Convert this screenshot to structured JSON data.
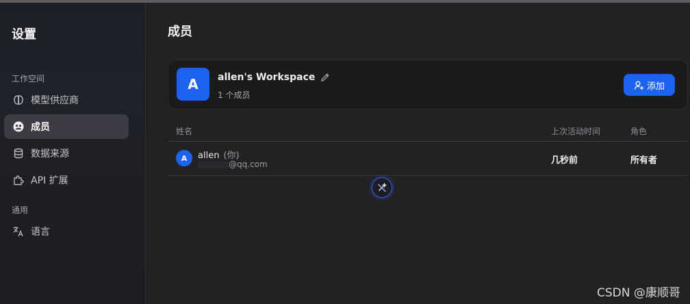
{
  "sidebar": {
    "title": "设置",
    "group_workspace": "工作空间",
    "group_general": "通用",
    "items": [
      {
        "label": "模型供应商",
        "icon": "brain-icon"
      },
      {
        "label": "成员",
        "icon": "members-icon",
        "active": true
      },
      {
        "label": "数据来源",
        "icon": "database-icon"
      },
      {
        "label": "API 扩展",
        "icon": "puzzle-icon"
      },
      {
        "label": "语言",
        "icon": "translate-icon"
      }
    ]
  },
  "main": {
    "title": "成员",
    "workspace": {
      "avatar_letter": "A",
      "name": "allen's Workspace",
      "member_count": "1 个成员",
      "add_button": "添加"
    },
    "table": {
      "headers": [
        "姓名",
        "上次活动时间",
        "角色"
      ],
      "rows": [
        {
          "avatar_letter": "A",
          "name": "allen",
          "you_tag": "(你)",
          "email_visible": "@qq.com",
          "last_active": "几秒前",
          "role": "所有者"
        }
      ]
    }
  },
  "watermark": "CSDN @康顺哥",
  "colors": {
    "accent": "#1d62f0",
    "background": "#222225",
    "sidebar": "#1e1f24",
    "active_item": "#3c3d44"
  }
}
